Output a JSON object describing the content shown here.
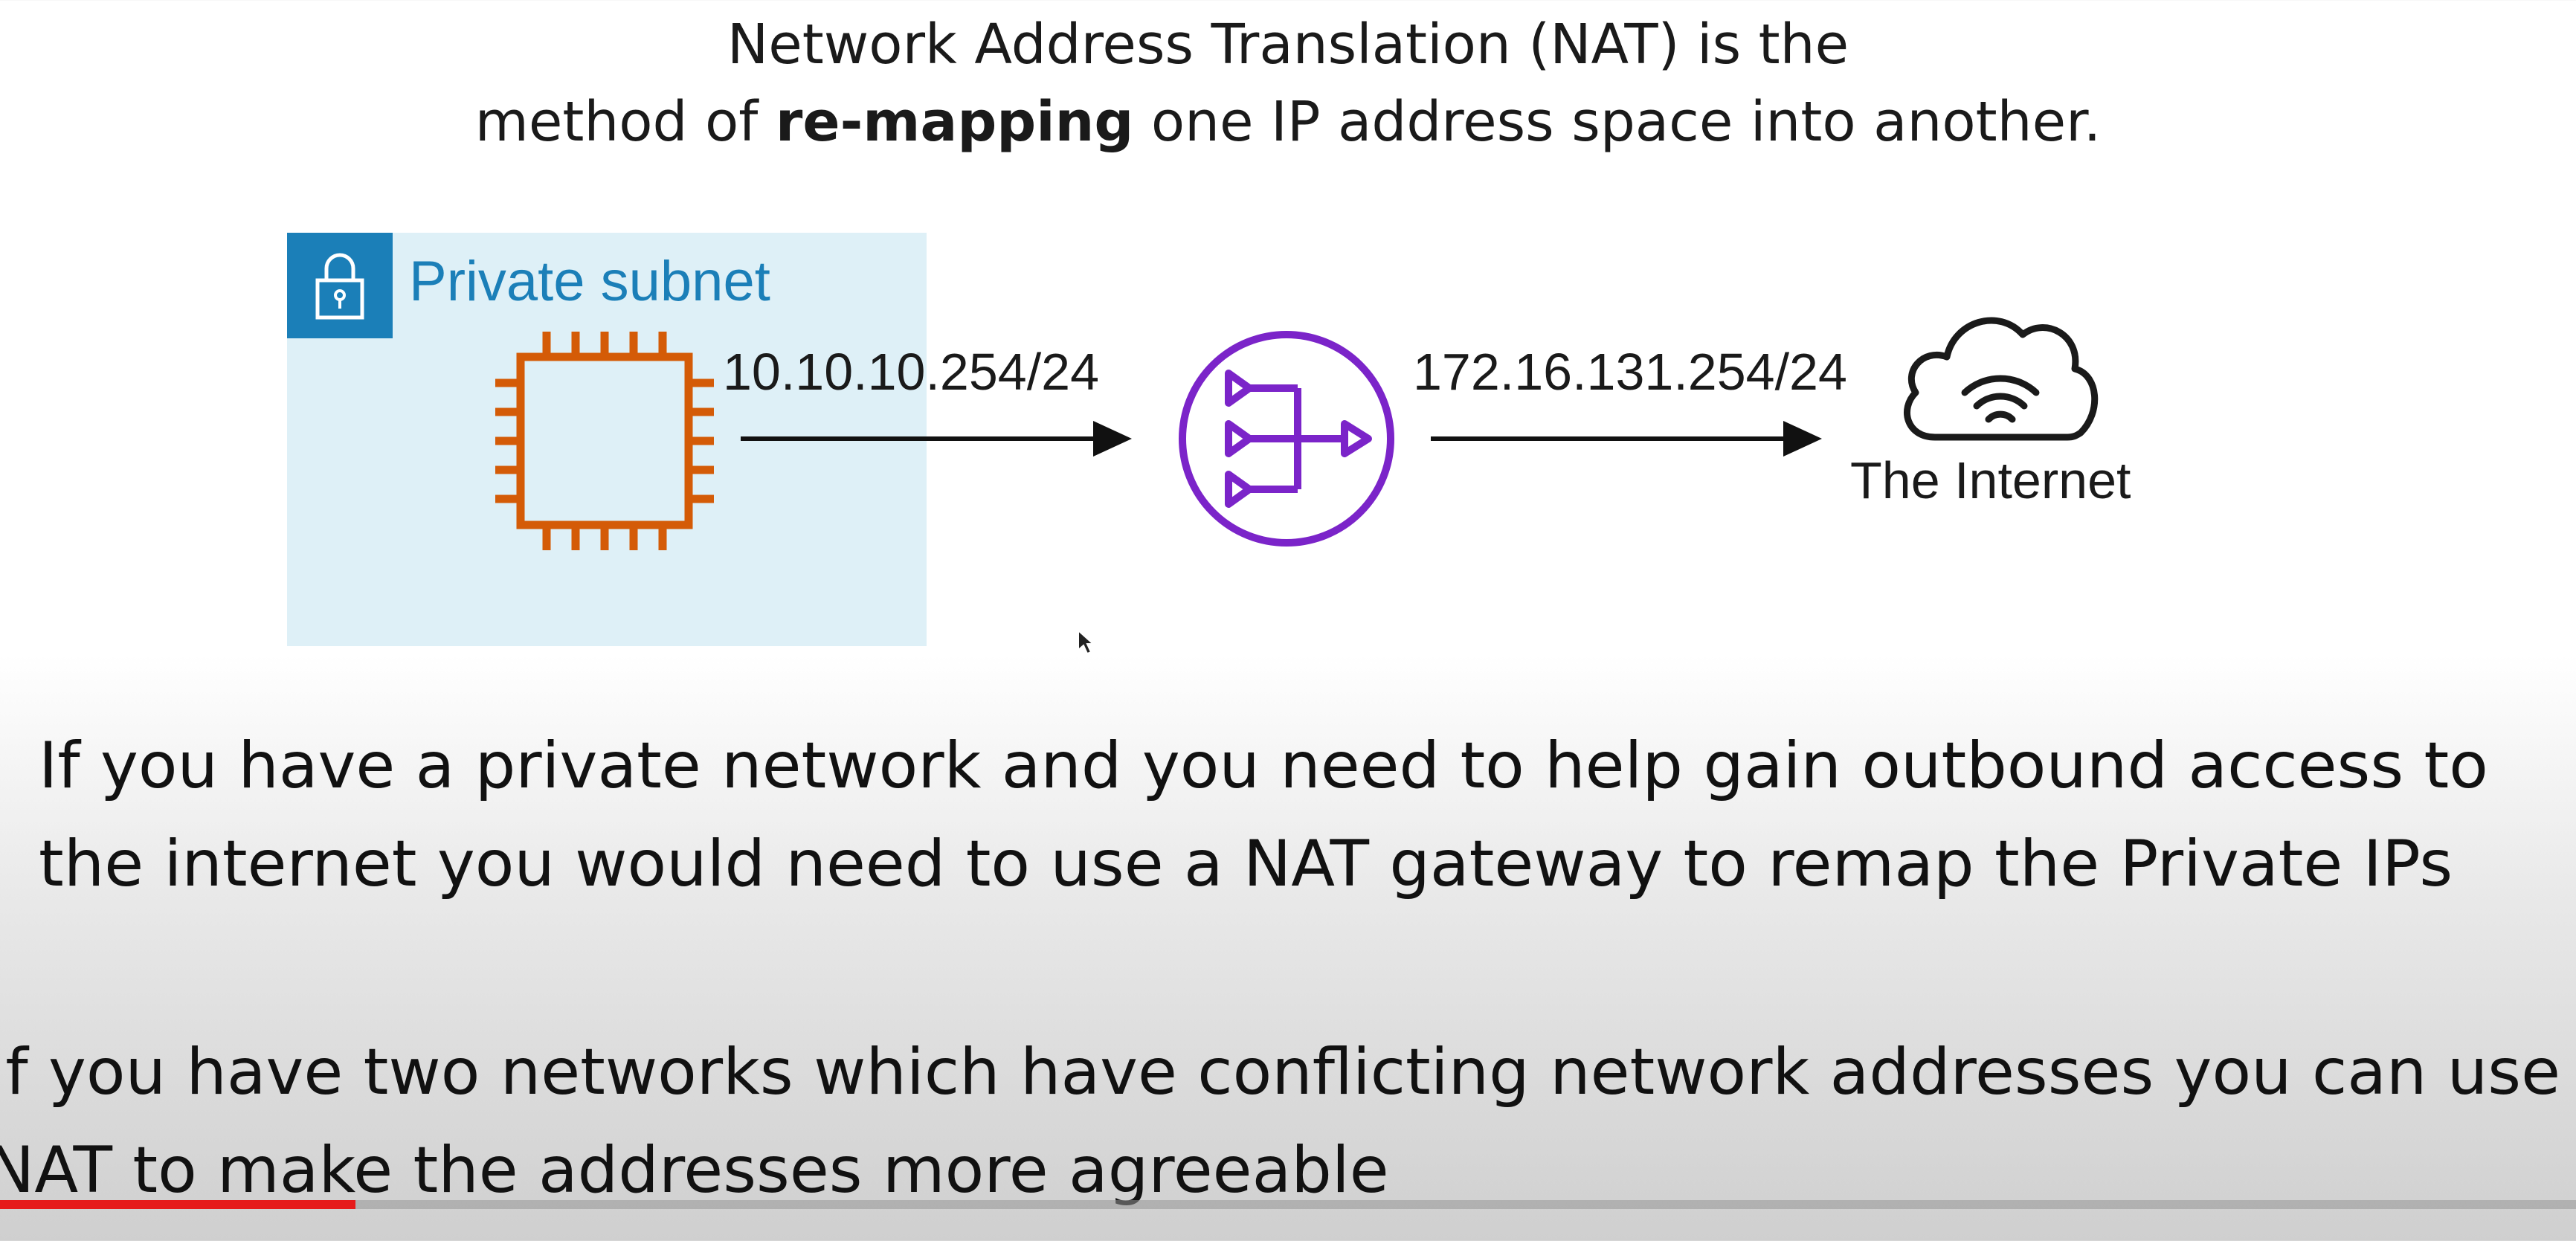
{
  "slide": {
    "heading_line1": "Network Address Translation (NAT) is the",
    "heading_line2_pre": "method of ",
    "heading_line2_bold": "re-mapping",
    "heading_line2_post": " one IP address space into another."
  },
  "diagram": {
    "subnet_label": "Private subnet",
    "private_ip": "10.10.10.254/24",
    "public_ip": "172.16.131.254/24",
    "internet_label": "The Internet",
    "icons": [
      "lock-icon",
      "ec2-instance-chip-icon",
      "nat-gateway-icon",
      "internet-cloud-icon"
    ],
    "colors": {
      "subnet_fill": "#def0f7",
      "subnet_accent": "#1b7fb8",
      "instance": "#d45b07",
      "nat": "#7b24c9"
    }
  },
  "captions": {
    "p1_line1": "If you have a private network and you need to help gain outbound access to",
    "p1_line2": "the internet you would need to use a NAT gateway to remap the Private IPs",
    "p2_line1": "If you have two networks which have conflicting network addresses you can use a",
    "p2_line2": "NAT to make the addresses more agreeable"
  },
  "player": {
    "progress_fraction": 0.138,
    "progress_color": "#e61b1b"
  }
}
